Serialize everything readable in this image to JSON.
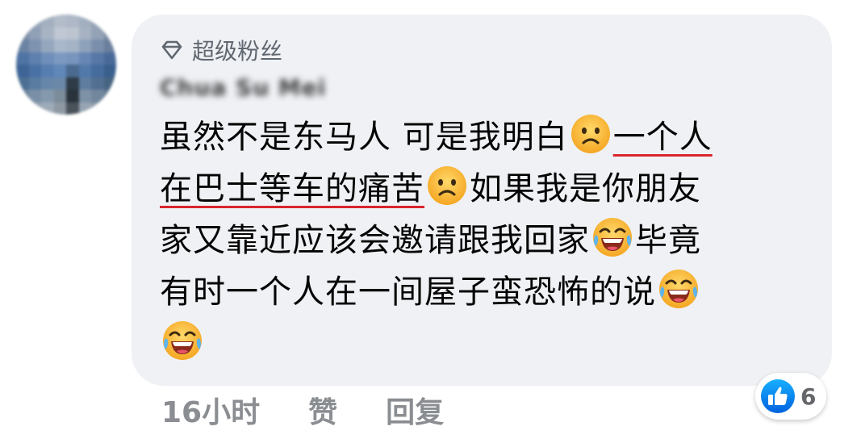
{
  "badge": {
    "icon": "diamond-icon",
    "label": "超级粉丝"
  },
  "author": {
    "name": "Chua Su Mei"
  },
  "comment": {
    "line1": {
      "text": "虽然不是东马人 可是我明白",
      "underlined": "一个人"
    },
    "line2": {
      "underlined": "在巴士等车的痛苦",
      "text": "如果我是你朋友"
    },
    "line3": {
      "text": "家又靠近应该会邀请跟我回家",
      "text_after": "毕竟"
    },
    "line4": {
      "text": "有时一个人在一间屋子蛮恐怖的说"
    },
    "emojis": [
      "frowning-face-emoji",
      "face-with-tears-of-joy-emoji"
    ],
    "underline_color": "#d9262c"
  },
  "actions": {
    "timestamp": "16小时",
    "like_label": "赞",
    "reply_label": "回复"
  },
  "reactions": {
    "icon": "thumbs-up-icon",
    "count": "6",
    "color": "#1877f2"
  }
}
